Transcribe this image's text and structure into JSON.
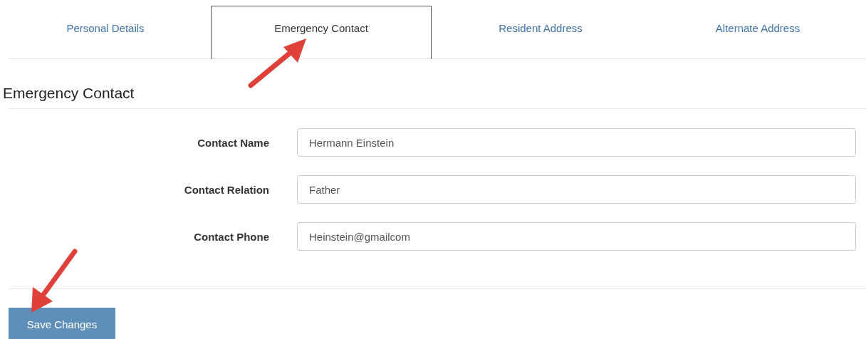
{
  "tabs": [
    {
      "label": "Personal Details",
      "selected": false
    },
    {
      "label": "Emergency Contact",
      "selected": true
    },
    {
      "label": "Resident Address",
      "selected": false
    },
    {
      "label": "Alternate Address",
      "selected": false
    }
  ],
  "section": {
    "title": "Emergency Contact"
  },
  "fields": [
    {
      "label": "Contact Name",
      "value": "Hermann Einstein"
    },
    {
      "label": "Contact Relation",
      "value": "Father"
    },
    {
      "label": "Contact Phone",
      "value": "Heinstein@gmailcom"
    }
  ],
  "buttons": [
    "Save Changes"
  ]
}
